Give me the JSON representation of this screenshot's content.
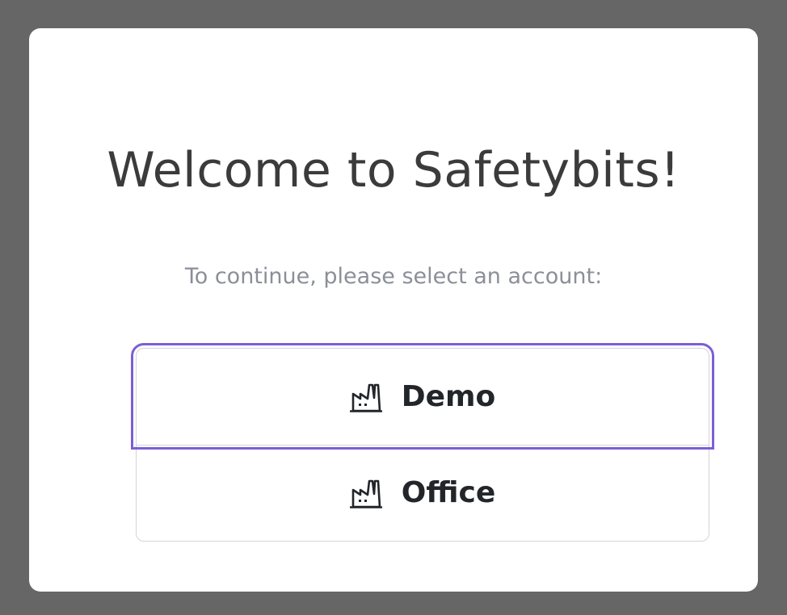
{
  "dialog": {
    "title": "Welcome to Safetybits!",
    "subtitle": "To continue, please select an account:"
  },
  "accounts": [
    {
      "label": "Demo",
      "icon": "factory-icon",
      "focused": true
    },
    {
      "label": "Office",
      "icon": "factory-icon",
      "focused": false
    }
  ],
  "colors": {
    "backdrop": "#666666",
    "title": "#3b3b3b",
    "subtitle": "#8b8f98",
    "focus_ring": "#7b5fd6",
    "button_border": "#d4d4d8"
  }
}
